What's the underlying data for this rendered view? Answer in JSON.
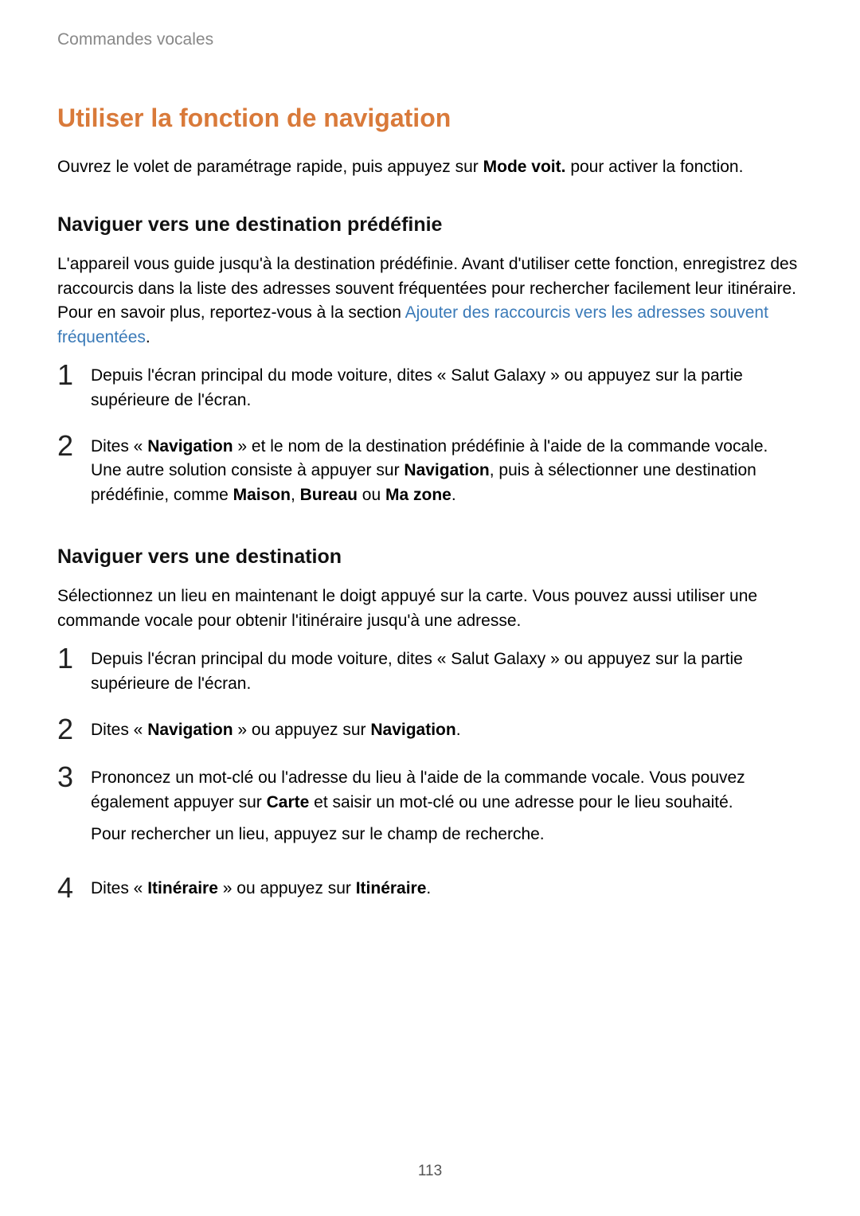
{
  "header": {
    "section": "Commandes vocales"
  },
  "title": "Utiliser la fonction de navigation",
  "intro": {
    "prefix": "Ouvrez le volet de paramétrage rapide, puis appuyez sur ",
    "bold": "Mode voit.",
    "suffix": " pour activer la fonction."
  },
  "section1": {
    "title": "Naviguer vers une destination prédéfinie",
    "desc_prefix": "L'appareil vous guide jusqu'à la destination prédéfinie. Avant d'utiliser cette fonction, enregistrez des raccourcis dans la liste des adresses souvent fréquentées pour rechercher facilement leur itinéraire. Pour en savoir plus, reportez-vous à la section ",
    "desc_link": "Ajouter des raccourcis vers les adresses souvent fréquentées",
    "desc_suffix": ".",
    "steps": {
      "s1": {
        "num": "1",
        "text": "Depuis l'écran principal du mode voiture, dites « Salut Galaxy » ou appuyez sur la partie supérieure de l'écran."
      },
      "s2": {
        "num": "2",
        "pre": "Dites « ",
        "b1": "Navigation",
        "mid1": " » et le nom de la destination prédéfinie à l'aide de la commande vocale. Une autre solution consiste à appuyer sur ",
        "b2": "Navigation",
        "mid2": ", puis à sélectionner une destination prédéfinie, comme ",
        "b3": "Maison",
        "sep1": ", ",
        "b4": "Bureau",
        "sep2": " ou ",
        "b5": "Ma zone",
        "end": "."
      }
    }
  },
  "section2": {
    "title": "Naviguer vers une destination",
    "desc": "Sélectionnez un lieu en maintenant le doigt appuyé sur la carte. Vous pouvez aussi utiliser une commande vocale pour obtenir l'itinéraire jusqu'à une adresse.",
    "steps": {
      "s1": {
        "num": "1",
        "text": "Depuis l'écran principal du mode voiture, dites « Salut Galaxy » ou appuyez sur la partie supérieure de l'écran."
      },
      "s2": {
        "num": "2",
        "pre": "Dites « ",
        "b1": "Navigation",
        "mid": " » ou appuyez sur ",
        "b2": "Navigation",
        "end": "."
      },
      "s3": {
        "num": "3",
        "p1_pre": "Prononcez un mot-clé ou l'adresse du lieu à l'aide de la commande vocale. Vous pouvez également appuyer sur ",
        "p1_b": "Carte",
        "p1_suf": " et saisir un mot-clé ou une adresse pour le lieu souhaité.",
        "p2": "Pour rechercher un lieu, appuyez sur le champ de recherche."
      },
      "s4": {
        "num": "4",
        "pre": "Dites « ",
        "b1": "Itinéraire",
        "mid": " » ou appuyez sur ",
        "b2": "Itinéraire",
        "end": "."
      }
    }
  },
  "page_number": "113"
}
